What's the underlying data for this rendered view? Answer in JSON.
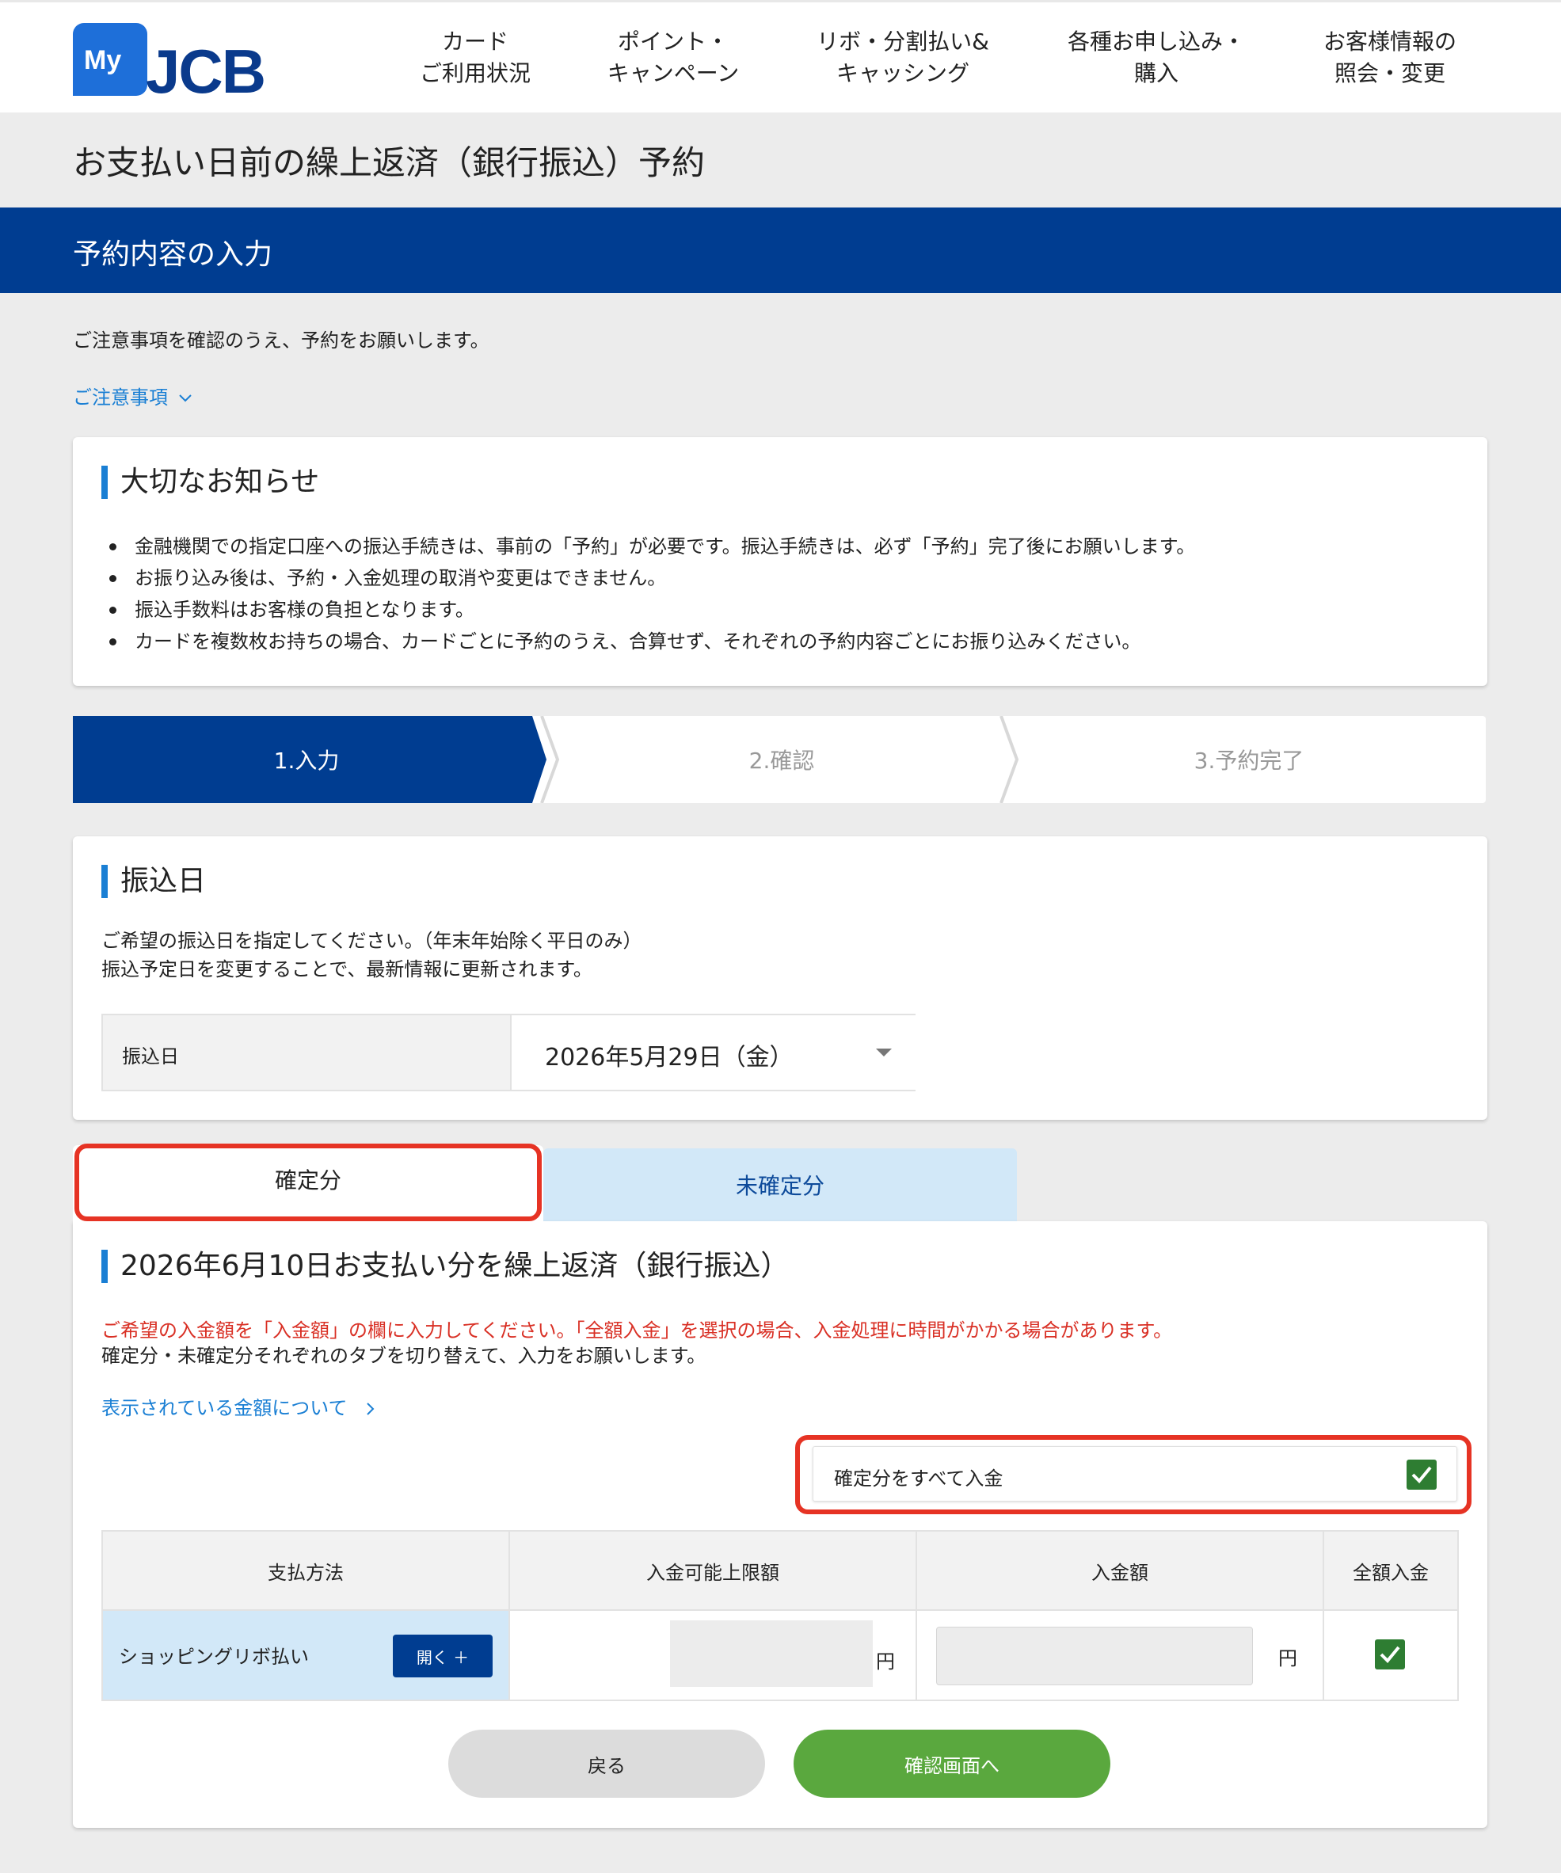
{
  "header": {
    "logo_my": "My",
    "logo_jcb": "JCB",
    "nav": [
      {
        "label": "カード\nご利用状況"
      },
      {
        "label": "ポイント・\nキャンペーン"
      },
      {
        "label": "リボ・分割払い&\nキャッシング"
      },
      {
        "label": "各種お申し込み・\n購入"
      },
      {
        "label": "お客様情報の\n照会・変更"
      }
    ]
  },
  "page_title": "お支払い日前の繰上返済（銀行振込）予約",
  "section_title": "予約内容の入力",
  "intro": "ご注意事項を確認のうえ、予約をお願いします。",
  "notice_link": "ご注意事項",
  "important": {
    "heading": "大切なお知らせ",
    "items": [
      "金融機関での指定口座への振込手続きは、事前の「予約」が必要です。振込手続きは、必ず「予約」完了後にお願いします。",
      "お振り込み後は、予約・入金処理の取消や変更はできません。",
      "振込手数料はお客様の負担となります。",
      "カードを複数枚お持ちの場合、カードごとに予約のうえ、合算せず、それぞれの予約内容ごとにお振り込みください。"
    ]
  },
  "steps": [
    {
      "label": "1.入力"
    },
    {
      "label": "2.確認"
    },
    {
      "label": "3.予約完了"
    }
  ],
  "transfer": {
    "heading": "振込日",
    "desc1": "ご希望の振込日を指定してください。（年末年始除く平日のみ）",
    "desc2": "振込予定日を変更することで、最新情報に更新されます。",
    "field_label": "振込日",
    "field_value": "2026年5月29日（金）"
  },
  "tabs": {
    "confirmed": "確定分",
    "unconfirmed": "未確定分"
  },
  "payment": {
    "heading": "2026年6月10日お支払い分を繰上返済（銀行振込）",
    "red_note": "ご希望の入金額を「入金額」の欄に入力してください。「全額入金」を選択の場合、入金処理に時間がかかる場合があります。",
    "note2": "確定分・未確定分それぞれのタブを切り替えて、入力をお願いします。",
    "amount_link": "表示されている金額について",
    "all_pay_label": "確定分をすべて入金"
  },
  "table": {
    "headers": [
      "支払方法",
      "入金可能上限額",
      "入金額",
      "全額入金"
    ],
    "rows": [
      {
        "method": "ショッピングリボ払い",
        "open_label": "開く ＋",
        "limit_unit": "円",
        "amount_unit": "円"
      }
    ]
  },
  "buttons": {
    "back": "戻る",
    "confirm": "確認画面へ"
  },
  "colors": {
    "brand_blue": "#003d91",
    "link_blue": "#1a7fd4",
    "alert_red": "#d93025",
    "highlight_red": "#e63324",
    "confirm_green": "#5aa83e",
    "check_green": "#2e7d32",
    "tab_inactive": "#d2e8f8"
  }
}
